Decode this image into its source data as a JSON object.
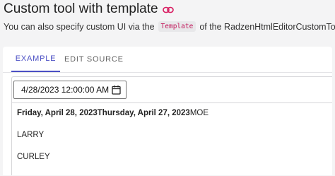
{
  "heading": {
    "title": "Custom tool with template",
    "link_icon": "link-icon"
  },
  "intro": {
    "before": "You can also specify custom UI via the",
    "code": "Template",
    "after": "of the RadzenHtmlEditorCustomTool."
  },
  "tabs": [
    {
      "label": "EXAMPLE",
      "active": true
    },
    {
      "label": "EDIT SOURCE",
      "active": false
    }
  ],
  "colors": {
    "accent": "#4b4fc4",
    "code_text": "#c2185b",
    "page_bg": "#f4f4f5"
  },
  "editor": {
    "date_value": "4/28/2023 12:00:00 AM",
    "calendar_icon": "calendar-icon",
    "content": {
      "date_today": "Friday, April 28, 2023",
      "date_yesterday": "Thursday, April 27, 2023",
      "name1": "MOE",
      "name2": "LARRY",
      "name3": "CURLEY"
    }
  }
}
